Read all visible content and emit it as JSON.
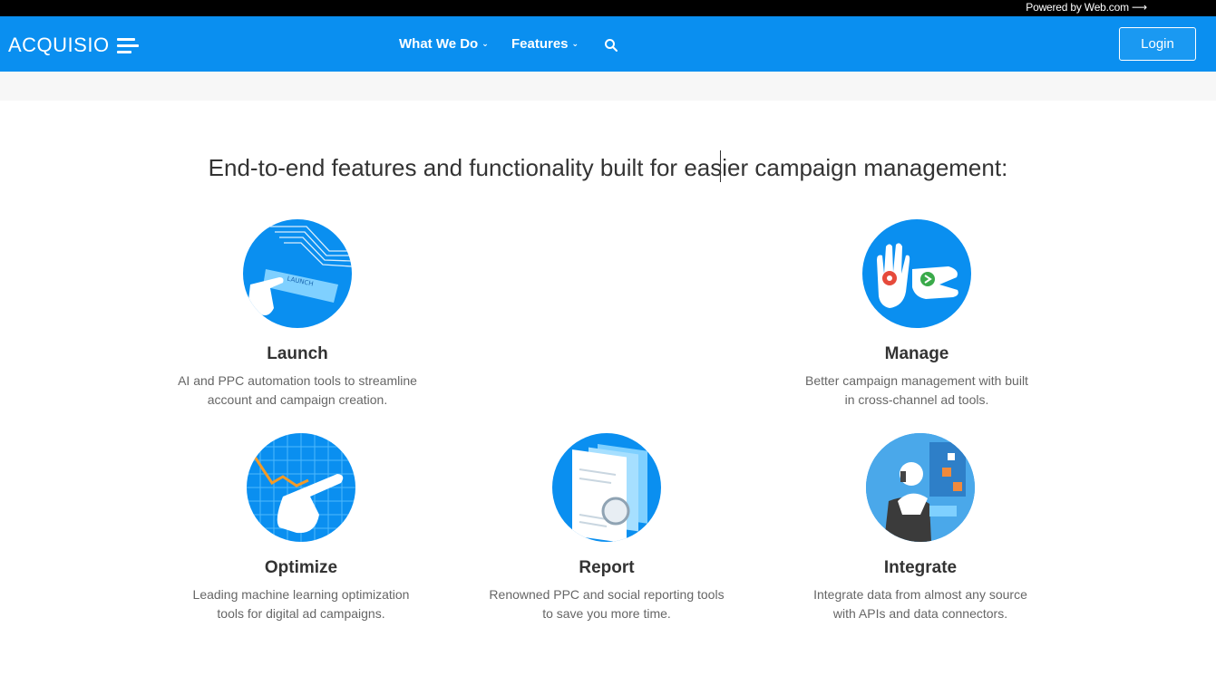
{
  "topbar": {
    "powered_label": "Powered by Web.com ⟶"
  },
  "nav": {
    "logo_text": "ACQUISIO",
    "menu": [
      {
        "label": "What We Do"
      },
      {
        "label": "Features"
      }
    ],
    "login_label": "Login",
    "colors": {
      "primary": "#0a8ff0",
      "bar": "#000000"
    }
  },
  "main": {
    "headline": "End-to-end features and functionality built for easier campaign management:",
    "features": [
      {
        "title": "Launch",
        "desc_line1": "AI and PPC automation tools to streamline",
        "desc_line2": "account and campaign creation.",
        "icon": "launch-icon"
      },
      {
        "title": "Manage",
        "desc_line1": "Better campaign management with built",
        "desc_line2": "in cross-channel ad tools.",
        "icon": "manage-icon"
      },
      {
        "title": "Optimize",
        "desc_line1": "Leading machine learning optimization",
        "desc_line2": "tools for digital ad campaigns.",
        "icon": "optimize-icon"
      },
      {
        "title": "Report",
        "desc_line1": "Renowned PPC and social reporting tools",
        "desc_line2": "to save you more time.",
        "icon": "report-icon"
      },
      {
        "title": "Integrate",
        "desc_line1": "Integrate data from almost any source",
        "desc_line2": "with APIs and data connectors.",
        "icon": "integrate-icon"
      }
    ]
  }
}
